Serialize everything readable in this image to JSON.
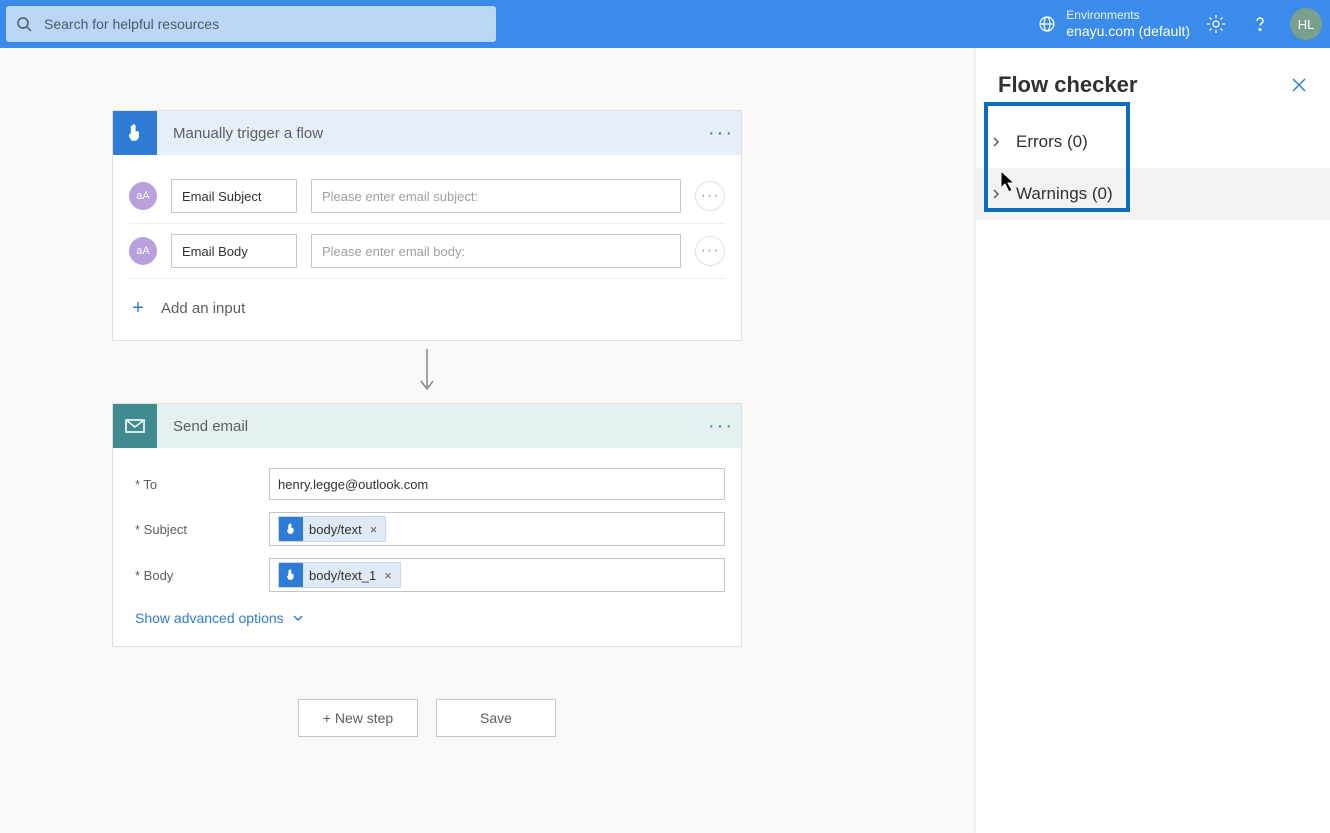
{
  "topbar": {
    "search_placeholder": "Search for helpful resources",
    "env_label": "Environments",
    "env_value": "enayu.com (default)",
    "avatar_initials": "HL"
  },
  "trigger": {
    "title": "Manually trigger a flow",
    "inputs": [
      {
        "badge": "aA",
        "label": "Email Subject",
        "placeholder": "Please enter email subject:"
      },
      {
        "badge": "aA",
        "label": "Email Body",
        "placeholder": "Please enter email body:"
      }
    ],
    "add_input_label": "Add an input"
  },
  "send_email": {
    "title": "Send email",
    "fields": {
      "to_label": "* To",
      "to_value": "henry.legge@outlook.com",
      "subject_label": "* Subject",
      "subject_token": "body/text",
      "body_label": "* Body",
      "body_token": "body/text_1"
    },
    "advanced_label": "Show advanced options"
  },
  "buttons": {
    "new_step": "+ New step",
    "save": "Save"
  },
  "panel": {
    "title": "Flow checker",
    "errors_label": "Errors (0)",
    "warnings_label": "Warnings (0)"
  }
}
